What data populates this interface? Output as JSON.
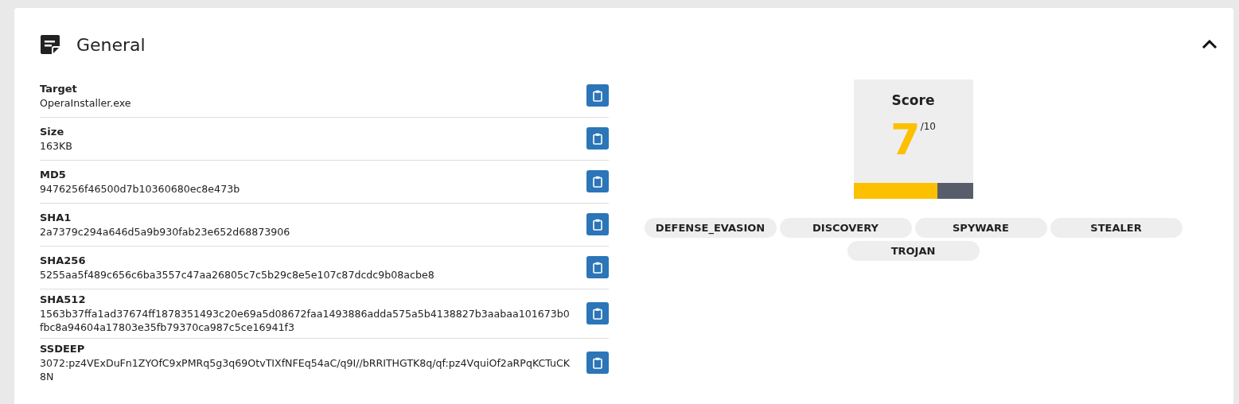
{
  "section": {
    "title": "General",
    "expanded": true
  },
  "fields": [
    {
      "label": "Target",
      "value": "OperaInstaller.exe"
    },
    {
      "label": "Size",
      "value": "163KB"
    },
    {
      "label": "MD5",
      "value": "9476256f46500d7b10360680ec8e473b"
    },
    {
      "label": "SHA1",
      "value": "2a7379c294a646d5a9b930fab23e652d68873906"
    },
    {
      "label": "SHA256",
      "value": "5255aa5f489c656c6ba3557c47aa26805c7c5b29c8e5e107c87dcdc9b08acbe8"
    },
    {
      "label": "SHA512",
      "value": "1563b37ffa1ad37674ff1878351493c20e69a5d08672faa1493886adda575a5b4138827b3aabaa101673b0fbc8a94604a17803e35fb79370ca987c5ce16941f3"
    },
    {
      "label": "SSDEEP",
      "value": "3072:pz4VExDuFn1ZYOfC9xPMRq5g3q69OtvTIXfNFEq54aC/q9I//bRRITHGTK8q/qf:pz4VquiOf2aRPqKCTuCK8N"
    }
  ],
  "score": {
    "title": "Score",
    "value": "7",
    "max": "/10",
    "level": 0.7
  },
  "tags": [
    "DEFENSE_EVASION",
    "DISCOVERY",
    "SPYWARE",
    "STEALER",
    "TROJAN"
  ]
}
